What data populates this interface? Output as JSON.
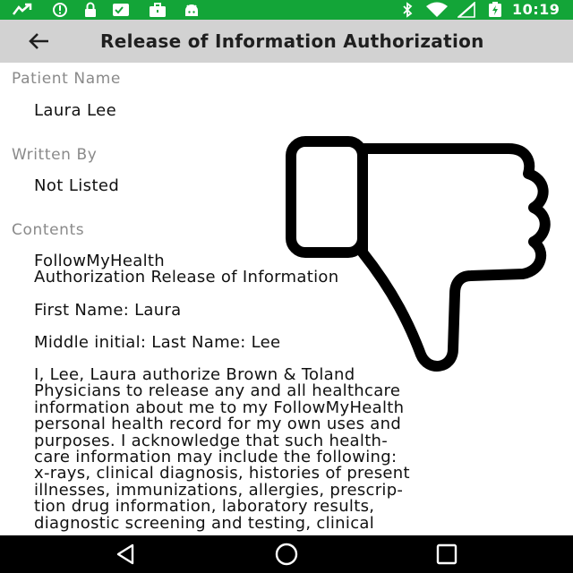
{
  "status_bar": {
    "time": "10:19",
    "left_icons": [
      "missed-call-icon",
      "alert-circle-icon",
      "lock-icon",
      "checklist-icon",
      "briefcase-icon",
      "android-icon"
    ],
    "right_icons": [
      "bluetooth-icon",
      "wifi-icon",
      "signal-icon",
      "battery-charging-icon"
    ]
  },
  "app_bar": {
    "title": "Release of Information Authorization"
  },
  "fields": {
    "patient_name_label": "Patient Name",
    "patient_name_value": "Laura Lee",
    "written_by_label": "Written By",
    "written_by_value": "Not Listed",
    "contents_label": "Contents"
  },
  "contents": {
    "lines": [
      "FollowMyHealth",
      "Authorization Release of Information",
      "",
      "First Name: Laura",
      "",
      "Middle initial:  Last Name: Lee",
      "",
      "I, Lee, Laura  authorize Brown & Toland",
      "Physicians to release any and all healthcare",
      "information about me to my FollowMyHealth",
      "personal health record for my own uses and",
      "purposes. I acknowledge that such health-",
      "care information may include the following:",
      "x-rays, clinical diagnosis, histories of present",
      "illnesses, immunizations, allergies, prescrip-",
      "tion drug information, laboratory results,",
      "diagnostic screening and testing, clinical"
    ]
  },
  "overlay": {
    "icon": "thumbs-down-icon"
  },
  "nav_bar": {
    "icons": [
      "back-triangle-icon",
      "home-circle-icon",
      "recents-square-icon"
    ]
  },
  "colors": {
    "status_bar": "#13a538",
    "app_bar": "#d2d2d2",
    "nav_bar": "#000000",
    "label_gray": "#8a8a8a"
  }
}
